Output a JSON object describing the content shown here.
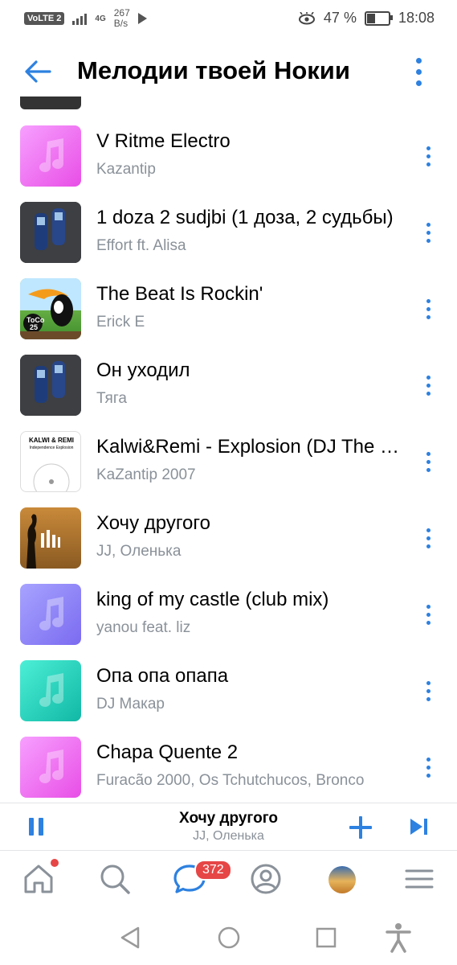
{
  "status_bar": {
    "volte": "VoLTE",
    "sim": "2",
    "net": "4G",
    "speed_value": "267",
    "speed_unit": "B/s",
    "battery": "47 %",
    "time": "18:08"
  },
  "header": {
    "title": "Мелодии твоей Нокии"
  },
  "tracks": [
    {
      "title": "V Ritme Electro",
      "artist": "Kazantip",
      "cover": "pink-note"
    },
    {
      "title": "1 doza 2 sudjbi (1 доза, 2 судьбы)",
      "artist": "Effort ft. Alisa",
      "cover": "nokia-phones"
    },
    {
      "title": "The Beat Is Rockin'",
      "artist": "Erick E",
      "cover": "toucan"
    },
    {
      "title": "Он уходил",
      "artist": "Тяга",
      "cover": "nokia-phones"
    },
    {
      "title": "Kalwi&Remi - Explosion (DJ The Bass Remix)",
      "artist": "KaZantip 2007",
      "cover": "kalwi-remi"
    },
    {
      "title": "Хочу другого",
      "artist": "JJ, Оленька",
      "cover": "sunset-silhouette"
    },
    {
      "title": "king of my castle (club mix)",
      "artist": "yanou feat. liz",
      "cover": "purple-note"
    },
    {
      "title": "Опа опа опапа",
      "artist": "DJ Макар",
      "cover": "teal-note"
    },
    {
      "title": "Chapa Quente 2",
      "artist": "Furacão 2000, Os Tchutchucos, Bronco",
      "cover": "pink-note"
    }
  ],
  "covers_text": {
    "toucan_logo": "ToCo 25",
    "kalwi_title": "KALWI & REMI",
    "kalwi_sub": "Independence Explosion"
  },
  "player": {
    "title": "Хочу другого",
    "artist": "JJ, Оленька",
    "state": "playing"
  },
  "tabbar": {
    "messages_badge": "372"
  },
  "colors": {
    "accent": "#2d81e0",
    "secondary_text": "#8a9199",
    "badge": "#e64646"
  }
}
